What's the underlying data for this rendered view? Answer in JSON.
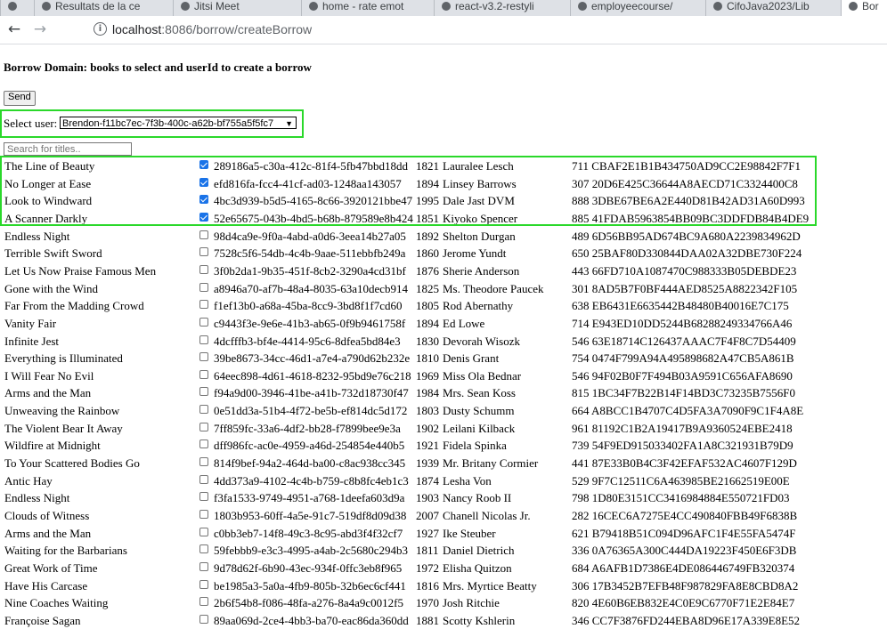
{
  "browser": {
    "tabs": [
      {
        "label": ""
      },
      {
        "label": "Resultats de la ce"
      },
      {
        "label": "Jitsi Meet"
      },
      {
        "label": "home - rate emot"
      },
      {
        "label": "react-v3.2-restyli"
      },
      {
        "label": "employeecourse/"
      },
      {
        "label": "CifoJava2023/Lib"
      },
      {
        "label": "Bor"
      }
    ],
    "url_host": "localhost",
    "url_path": ":8086/borrow/createBorrow"
  },
  "page": {
    "title": "Borrow Domain: books to select and userId to create a borrow",
    "send_label": "Send",
    "select_user_label": "Select user:",
    "selected_user": "Brendon-f11bc7ec-7f3b-400c-a62b-bf755a5f5fc7",
    "search_placeholder": "Search for titles.."
  },
  "books": [
    {
      "title": "The Line of Beauty",
      "checked": true,
      "id": "289186a5-c30a-412c-81f4-5fb47bbd18dd",
      "year": "1821",
      "author": "Lauralee Lesch",
      "num": "711 CBAF2E1B1B434750AD9CC2E98842F7F1"
    },
    {
      "title": "No Longer at Ease",
      "checked": true,
      "id": "efd816fa-fcc4-41cf-ad03-1248aa143057",
      "year": "1894",
      "author": "Linsey Barrows",
      "num": "307 20D6E425C36644A8AECD71C3324400C8"
    },
    {
      "title": "Look to Windward",
      "checked": true,
      "id": "4bc3d939-b5d5-4165-8c66-3920121bbe47",
      "year": "1995",
      "author": "Dale Jast DVM",
      "num": "888 3DBE67BE6A2E440D81B42AD31A60D993"
    },
    {
      "title": "A Scanner Darkly",
      "checked": true,
      "id": "52e65675-043b-4bd5-b68b-879589e8b424",
      "year": "1851",
      "author": "Kiyoko Spencer",
      "num": "885 41FDAB5963854BB09BC3DDFDB84B4DE9"
    },
    {
      "title": "Endless Night",
      "checked": false,
      "id": "98d4ca9e-9f0a-4abd-a0d6-3eea14b27a05",
      "year": "1892",
      "author": "Shelton Durgan",
      "num": "489 6D56BB95AD674BC9A680A2239834962D"
    },
    {
      "title": "Terrible Swift Sword",
      "checked": false,
      "id": "7528c5f6-54db-4c4b-9aae-511ebbfb249a",
      "year": "1860",
      "author": "Jerome Yundt",
      "num": "650 25BAF80D330844DAA02A32DBE730F224"
    },
    {
      "title": "Let Us Now Praise Famous Men",
      "checked": false,
      "id": "3f0b2da1-9b35-451f-8cb2-3290a4cd31bf",
      "year": "1876",
      "author": "Sherie Anderson",
      "num": "443 66FD710A1087470C988333B05DEBDE23"
    },
    {
      "title": "Gone with the Wind",
      "checked": false,
      "id": "a8946a70-af7b-48a4-8035-63a10decb914",
      "year": "1825",
      "author": "Ms. Theodore Paucek",
      "num": "301 8AD5B7F0BF444AED8525A8822342F105"
    },
    {
      "title": "Far From the Madding Crowd",
      "checked": false,
      "id": "f1ef13b0-a68a-45ba-8cc9-3bd8f1f7cd60",
      "year": "1805",
      "author": "Rod Abernathy",
      "num": "638 EB6431E6635442B48480B40016E7C175"
    },
    {
      "title": "Vanity Fair",
      "checked": false,
      "id": "c9443f3e-9e6e-41b3-ab65-0f9b9461758f",
      "year": "1894",
      "author": "Ed Lowe",
      "num": "714 E943ED10DD5244B68288249334766A46"
    },
    {
      "title": "Infinite Jest",
      "checked": false,
      "id": "4dcfffb3-bf4e-4414-95c6-8dfea5bd84e3",
      "year": "1830",
      "author": "Devorah Wisozk",
      "num": "546 63E18714C126437AAAC7F4F8C7D54409"
    },
    {
      "title": "Everything is Illuminated",
      "checked": false,
      "id": "39be8673-34cc-46d1-a7e4-a790d62b232e",
      "year": "1810",
      "author": "Denis Grant",
      "num": "754 0474F799A94A495898682A47CB5A861B"
    },
    {
      "title": "I Will Fear No Evil",
      "checked": false,
      "id": "64eec898-4d61-4618-8232-95bd9e76c218",
      "year": "1969",
      "author": "Miss Ola Bednar",
      "num": "546 94F02B0F7F494B03A9591C656AFA8690"
    },
    {
      "title": "Arms and the Man",
      "checked": false,
      "id": "f94a9d00-3946-41be-a41b-732d18730f47",
      "year": "1984",
      "author": "Mrs. Sean Koss",
      "num": "815 1BC34F7B22B14F14BD3C73235B7556F0"
    },
    {
      "title": "Unweaving the Rainbow",
      "checked": false,
      "id": "0e51dd3a-51b4-4f72-be5b-ef814dc5d172",
      "year": "1803",
      "author": "Dusty Schumm",
      "num": "664 A8BCC1B4707C4D5FA3A7090F9C1F4A8E"
    },
    {
      "title": "The Violent Bear It Away",
      "checked": false,
      "id": "7ff859fc-33a6-4df2-bb28-f7899bee9e3a",
      "year": "1902",
      "author": "Leilani Kilback",
      "num": "961 81192C1B2A19417B9A9360524EBE2418"
    },
    {
      "title": "Wildfire at Midnight",
      "checked": false,
      "id": "dff986fc-ac0e-4959-a46d-254854e440b5",
      "year": "1921",
      "author": "Fidela Spinka",
      "num": "739 54F9ED915033402FA1A8C321931B79D9"
    },
    {
      "title": "To Your Scattered Bodies Go",
      "checked": false,
      "id": "814f9bef-94a2-464d-ba00-c8ac938cc345",
      "year": "1939",
      "author": "Mr. Britany Cormier",
      "num": "441 87E33B0B4C3F42EFAF532AC4607F129D"
    },
    {
      "title": "Antic Hay",
      "checked": false,
      "id": "4dd373a9-4102-4c4b-b759-c8b8fc4eb1c3",
      "year": "1874",
      "author": "Lesha Von",
      "num": "529 9F7C12511C6A463985BE21662519E00E"
    },
    {
      "title": "Endless Night",
      "checked": false,
      "id": "f3fa1533-9749-4951-a768-1deefa603d9a",
      "year": "1903",
      "author": "Nancy Roob II",
      "num": "798 1D80E3151CC3416984884E550721FD03"
    },
    {
      "title": "Clouds of Witness",
      "checked": false,
      "id": "1803b953-60ff-4a5e-91c7-519df8d09d38",
      "year": "2007",
      "author": "Chanell Nicolas Jr.",
      "num": "282 16CEC6A7275E4CC490840FBB49F6838B"
    },
    {
      "title": "Arms and the Man",
      "checked": false,
      "id": "c0bb3eb7-14f8-49c3-8c95-abd3f4f32cf7",
      "year": "1927",
      "author": "Ike Steuber",
      "num": "621 B79418B51C094D96AFC1F4E55FA5474F"
    },
    {
      "title": "Waiting for the Barbarians",
      "checked": false,
      "id": "59febbb9-e3c3-4995-a4ab-2c5680c294b3",
      "year": "1811",
      "author": "Daniel Dietrich",
      "num": "336 0A76365A300C444DA19223F450E6F3DB"
    },
    {
      "title": "Great Work of Time",
      "checked": false,
      "id": "9d78d62f-6b90-43ec-934f-0ffc3eb8f965",
      "year": "1972",
      "author": "Elisha Quitzon",
      "num": "684 A6AFB1D7386E4DE086446749FB320374"
    },
    {
      "title": "Have His Carcase",
      "checked": false,
      "id": "be1985a3-5a0a-4fb9-805b-32b6ec6cf441",
      "year": "1816",
      "author": "Mrs. Myrtice Beatty",
      "num": "306 17B3452B7EFB48F987829FA8E8CBD8A2"
    },
    {
      "title": "Nine Coaches Waiting",
      "checked": false,
      "id": "2b6f54b8-f086-48fa-a276-8a4a9c0012f5",
      "year": "1970",
      "author": "Josh Ritchie",
      "num": "820 4E60B6EB832E4C0E9C6770F71E2E84E7"
    },
    {
      "title": "Françoise Sagan",
      "checked": false,
      "id": "89aa069d-2ce4-4bb3-ba70-eac86da360dd",
      "year": "1881",
      "author": "Scotty Kshlerin",
      "num": "346 CC7F3876FD244EBA8D96E17A339E8E52"
    }
  ]
}
